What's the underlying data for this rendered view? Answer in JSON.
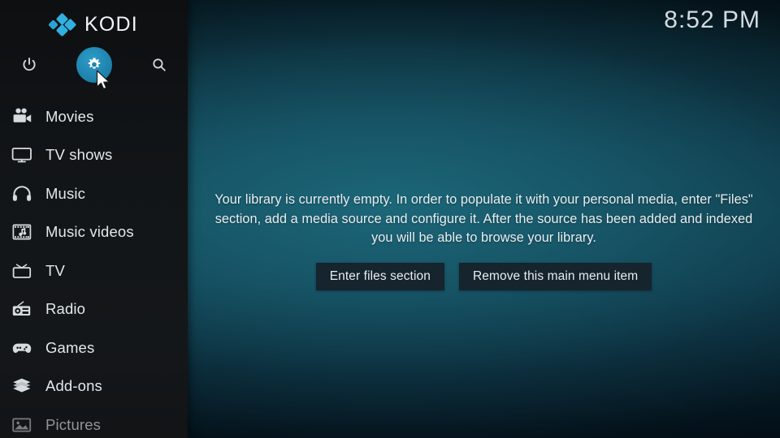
{
  "app": {
    "name": "KODI",
    "logo_color": "#31b0e0"
  },
  "header": {
    "clock": "8:52 PM"
  },
  "top_actions": [
    {
      "name": "power",
      "label": "Power",
      "icon": "power-icon",
      "selected": false
    },
    {
      "name": "settings",
      "label": "Settings",
      "icon": "gear-icon",
      "selected": true,
      "accent": "#1e83ad"
    },
    {
      "name": "search",
      "label": "Search",
      "icon": "search-icon",
      "selected": false
    }
  ],
  "sidebar": {
    "background": "#131619",
    "items": [
      {
        "label": "Movies",
        "icon": "movie-camera-icon",
        "dim": false
      },
      {
        "label": "TV shows",
        "icon": "tv-monitor-icon",
        "dim": false
      },
      {
        "label": "Music",
        "icon": "headphones-icon",
        "dim": false
      },
      {
        "label": "Music videos",
        "icon": "film-music-icon",
        "dim": false
      },
      {
        "label": "TV",
        "icon": "retro-tv-icon",
        "dim": false
      },
      {
        "label": "Radio",
        "icon": "radio-icon",
        "dim": false
      },
      {
        "label": "Games",
        "icon": "gamepad-icon",
        "dim": false
      },
      {
        "label": "Add-ons",
        "icon": "package-box-icon",
        "dim": false
      },
      {
        "label": "Pictures",
        "icon": "picture-icon",
        "dim": true
      }
    ]
  },
  "main": {
    "empty_message": "Your library is currently empty. In order to populate it with your personal media, enter \"Files\" section, add a media source and configure it. After the source has been added and indexed you will be able to browse your library.",
    "buttons": [
      {
        "label": "Enter files section"
      },
      {
        "label": "Remove this main menu item"
      }
    ]
  },
  "theme": {
    "background_top": "#04121a",
    "background_mid": "#145163",
    "background_bottom": "#03101a",
    "accent": "#1e83ad",
    "button_bg": "#16242d",
    "text": "#e9eef0"
  }
}
